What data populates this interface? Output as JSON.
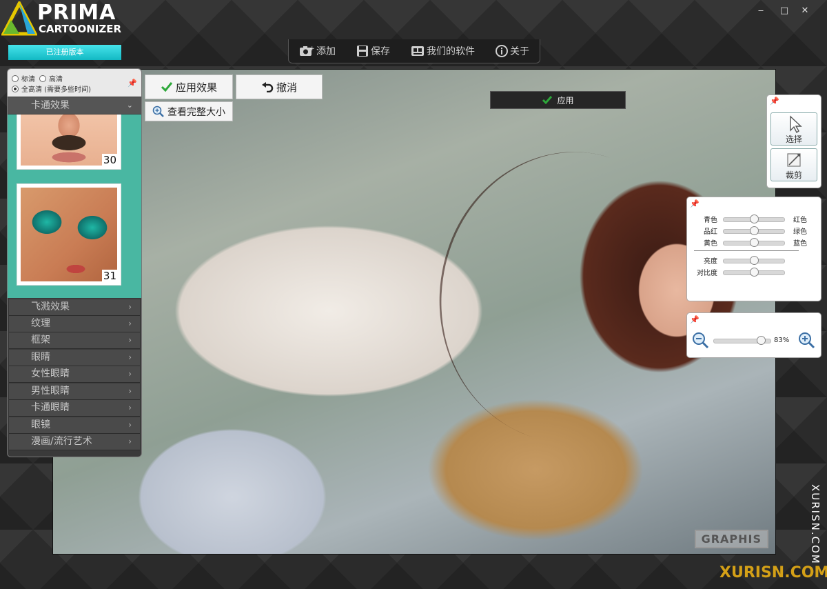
{
  "app": {
    "logo_line1": "PRIMA",
    "logo_line2": "CARTOONIZER",
    "registered_label": "已注册版本"
  },
  "window_controls": {
    "minimize": "‒",
    "maximize": "□",
    "close": "✕"
  },
  "toolbar": {
    "add_label": "添加",
    "save_label": "保存",
    "our_software_label": "我们的软件",
    "about_label": "关于"
  },
  "quality": {
    "standard": "标清",
    "hd": "高清",
    "full_hd": "全高清 (需要多些时间)",
    "selected": "full_hd"
  },
  "effects": {
    "header": "卡通效果",
    "thumbnails": [
      {
        "number": "30",
        "subject": "mustache face"
      },
      {
        "number": "31",
        "subject": "sunglasses face"
      }
    ],
    "categories": [
      "飞溅效果",
      "纹理",
      "框架",
      "眼睛",
      "女性眼睛",
      "男性眼睛",
      "卡通眼睛",
      "眼镜",
      "漫画/流行艺术"
    ]
  },
  "actions": {
    "apply_effect": "应用效果",
    "undo": "撤消",
    "view_full_size": "查看完整大小",
    "apply": "应用"
  },
  "tools": {
    "select": "选择",
    "crop": "裁剪"
  },
  "color_adjust": {
    "balance": [
      {
        "left": "青色",
        "right": "红色",
        "value": 0.5
      },
      {
        "left": "品红",
        "right": "绿色",
        "value": 0.5
      },
      {
        "left": "黄色",
        "right": "蓝色",
        "value": 0.5
      }
    ],
    "tone": [
      {
        "label": "亮度",
        "value": 0.5
      },
      {
        "label": "对比度",
        "value": 0.5
      }
    ]
  },
  "zoom": {
    "value_label": "83%",
    "value": 0.83
  },
  "canvas": {
    "signature": "GRAPHIS"
  },
  "watermark": {
    "vertical": "XURISN.COM",
    "bottom": "XURISN.COM"
  },
  "colors": {
    "accent": "#13b9c4",
    "panel_teal": "#49b7a2",
    "check_green": "#2da83a"
  }
}
